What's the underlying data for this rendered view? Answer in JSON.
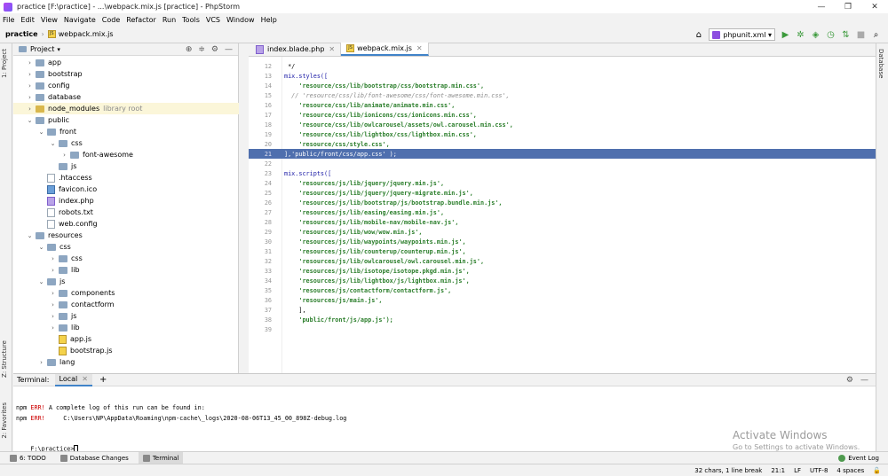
{
  "window": {
    "title": "practice [F:\\practice] - ...\\webpack.mix.js [practice] - PhpStorm",
    "min": "—",
    "max": "❐",
    "close": "✕"
  },
  "menu": [
    "File",
    "Edit",
    "View",
    "Navigate",
    "Code",
    "Refactor",
    "Run",
    "Tools",
    "VCS",
    "Window",
    "Help"
  ],
  "breadcrumb": {
    "project": "practice",
    "file": "webpack.mix.js"
  },
  "run_config": "phpunit.xml",
  "left_tabs": {
    "project": "1: Project",
    "structure": "Z: Structure",
    "favorites": "2: Favorites"
  },
  "right_tabs": {
    "database": "Database"
  },
  "project_panel": {
    "title": "Project",
    "tree": [
      {
        "depth": 0,
        "arrow": "›",
        "type": "folder",
        "label": "app"
      },
      {
        "depth": 0,
        "arrow": "›",
        "type": "folder",
        "label": "bootstrap"
      },
      {
        "depth": 0,
        "arrow": "›",
        "type": "folder",
        "label": "config"
      },
      {
        "depth": 0,
        "arrow": "›",
        "type": "folder",
        "label": "database"
      },
      {
        "depth": 0,
        "arrow": "›",
        "type": "folder-yellow",
        "label": "node_modules",
        "extra": "library root",
        "highlight": true
      },
      {
        "depth": 0,
        "arrow": "⌄",
        "type": "folder",
        "label": "public"
      },
      {
        "depth": 1,
        "arrow": "⌄",
        "type": "folder",
        "label": "front"
      },
      {
        "depth": 2,
        "arrow": "⌄",
        "type": "folder",
        "label": "css"
      },
      {
        "depth": 3,
        "arrow": "›",
        "type": "folder",
        "label": "font-awesome"
      },
      {
        "depth": 2,
        "arrow": "",
        "type": "folder",
        "label": "js"
      },
      {
        "depth": 1,
        "arrow": "",
        "type": "file",
        "label": ".htaccess"
      },
      {
        "depth": 1,
        "arrow": "",
        "type": "file-ico",
        "label": "favicon.ico"
      },
      {
        "depth": 1,
        "arrow": "",
        "type": "file-php",
        "label": "index.php"
      },
      {
        "depth": 1,
        "arrow": "",
        "type": "file",
        "label": "robots.txt"
      },
      {
        "depth": 1,
        "arrow": "",
        "type": "file",
        "label": "web.config"
      },
      {
        "depth": 0,
        "arrow": "⌄",
        "type": "folder",
        "label": "resources"
      },
      {
        "depth": 1,
        "arrow": "⌄",
        "type": "folder",
        "label": "css"
      },
      {
        "depth": 2,
        "arrow": "›",
        "type": "folder",
        "label": "css"
      },
      {
        "depth": 2,
        "arrow": "›",
        "type": "folder",
        "label": "lib"
      },
      {
        "depth": 1,
        "arrow": "⌄",
        "type": "folder",
        "label": "js"
      },
      {
        "depth": 2,
        "arrow": "›",
        "type": "folder",
        "label": "components"
      },
      {
        "depth": 2,
        "arrow": "›",
        "type": "folder",
        "label": "contactform"
      },
      {
        "depth": 2,
        "arrow": "›",
        "type": "folder",
        "label": "js"
      },
      {
        "depth": 2,
        "arrow": "›",
        "type": "folder",
        "label": "lib"
      },
      {
        "depth": 2,
        "arrow": "",
        "type": "file-js",
        "label": "app.js"
      },
      {
        "depth": 2,
        "arrow": "",
        "type": "file-js",
        "label": "bootstrap.js"
      },
      {
        "depth": 1,
        "arrow": "›",
        "type": "folder",
        "label": "lang"
      }
    ]
  },
  "editor": {
    "tabs": [
      {
        "label": "index.blade.php",
        "active": false
      },
      {
        "label": "webpack.mix.js",
        "active": true
      }
    ],
    "lines": [
      {
        "n": "12",
        "text": " */",
        "kind": "plain"
      },
      {
        "n": "13",
        "text": "mix.styles([",
        "kind": "kw"
      },
      {
        "n": "14",
        "text": "    'resource/css/lib/bootstrap/css/bootstrap.min.css',",
        "kind": "str"
      },
      {
        "n": "15",
        "text": "  // 'resource/css/lib/font-awesome/css/font-awesome.min.css',",
        "kind": "cm"
      },
      {
        "n": "16",
        "text": "    'resource/css/lib/animate/animate.min.css',",
        "kind": "str"
      },
      {
        "n": "17",
        "text": "    'resource/css/lib/ionicons/css/ionicons.min.css',",
        "kind": "str"
      },
      {
        "n": "18",
        "text": "    'resource/css/lib/owlcarousel/assets/owl.carousel.min.css',",
        "kind": "str"
      },
      {
        "n": "19",
        "text": "    'resource/css/lib/lightbox/css/lightbox.min.css',",
        "kind": "str"
      },
      {
        "n": "20",
        "text": "    'resource/css/style.css',",
        "kind": "str"
      },
      {
        "n": "21",
        "text": "],'public/front/css/app.css' );",
        "kind": "sel"
      },
      {
        "n": "22",
        "text": "",
        "kind": "plain"
      },
      {
        "n": "23",
        "text": "mix.scripts([",
        "kind": "kw"
      },
      {
        "n": "24",
        "text": "    'resources/js/lib/jquery/jquery.min.js',",
        "kind": "str"
      },
      {
        "n": "25",
        "text": "    'resources/js/lib/jquery/jquery-migrate.min.js',",
        "kind": "str"
      },
      {
        "n": "26",
        "text": "    'resources/js/lib/bootstrap/js/bootstrap.bundle.min.js',",
        "kind": "str"
      },
      {
        "n": "27",
        "text": "    'resources/js/lib/easing/easing.min.js',",
        "kind": "str"
      },
      {
        "n": "28",
        "text": "    'resources/js/lib/mobile-nav/mobile-nav.js',",
        "kind": "str"
      },
      {
        "n": "29",
        "text": "    'resources/js/lib/wow/wow.min.js',",
        "kind": "str"
      },
      {
        "n": "30",
        "text": "    'resources/js/lib/waypoints/waypoints.min.js',",
        "kind": "str"
      },
      {
        "n": "31",
        "text": "    'resources/js/lib/counterup/counterup.min.js',",
        "kind": "str"
      },
      {
        "n": "32",
        "text": "    'resources/js/lib/owlcarousel/owl.carousel.min.js',",
        "kind": "str"
      },
      {
        "n": "33",
        "text": "    'resources/js/lib/isotope/isotope.pkgd.min.js',",
        "kind": "str"
      },
      {
        "n": "34",
        "text": "    'resources/js/lib/lightbox/js/lightbox.min.js',",
        "kind": "str"
      },
      {
        "n": "35",
        "text": "    'resources/js/contactform/contactform.js',",
        "kind": "str"
      },
      {
        "n": "36",
        "text": "    'resources/js/main.js',",
        "kind": "str"
      },
      {
        "n": "37",
        "text": "    ],",
        "kind": "plain"
      },
      {
        "n": "38",
        "text": "    'public/front/js/app.js');",
        "kind": "str"
      },
      {
        "n": "39",
        "text": "",
        "kind": "plain"
      }
    ]
  },
  "terminal": {
    "label": "Terminal:",
    "tab": "Local",
    "lines": [
      {
        "prefix": "npm ",
        "err": "ERR!",
        "rest": " A complete log of this run can be found in:"
      },
      {
        "prefix": "npm ",
        "err": "ERR!",
        "rest": "     C:\\Users\\NP\\AppData\\Roaming\\npm-cache\\_logs\\2020-08-06T13_45_00_898Z-debug.log"
      }
    ],
    "prompt": "F:\\practice>"
  },
  "watermark": {
    "title": "Activate Windows",
    "subtitle": "Go to Settings to activate Windows."
  },
  "bottom_tabs": [
    {
      "label": "6: TODO",
      "active": false
    },
    {
      "label": "Database Changes",
      "active": false
    },
    {
      "label": "Terminal",
      "active": true
    }
  ],
  "event_log": "Event Log",
  "status": {
    "selection": "32 chars, 1 line break",
    "position": "21:1",
    "line_sep": "LF",
    "encoding": "UTF-8",
    "indent": "4 spaces"
  }
}
